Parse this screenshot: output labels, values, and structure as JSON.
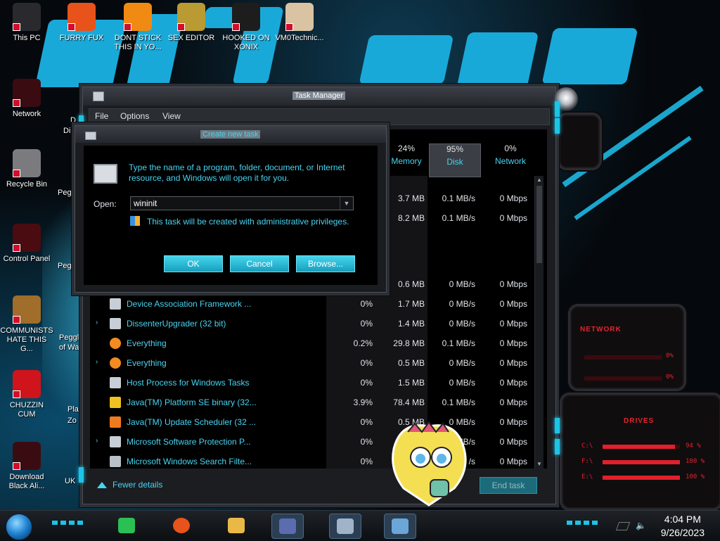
{
  "desktop": {
    "icons": [
      {
        "label": "This PC",
        "color": "#2a2a2e",
        "glyph": "pc-icon"
      },
      {
        "label": "FURRY FUX",
        "color": "#e8531b",
        "glyph": "firefox-icon"
      },
      {
        "label": "DONT STICK THIS IN YO...",
        "color": "#f08a12",
        "glyph": "vlc-icon"
      },
      {
        "label": "SEX EDITOR",
        "color": "#b99a33",
        "glyph": "hxd-icon"
      },
      {
        "label": "HOOKED ON XONIX",
        "color": "#1d1d1d",
        "glyph": "xonix-icon"
      },
      {
        "label": "VM0Technic...",
        "color": "#d9c3a3",
        "glyph": "doctor-icon"
      },
      {
        "label": "Network",
        "color": "#3a0c12",
        "glyph": "alien-network-icon"
      },
      {
        "label": "Recycle Bin",
        "color": "#7b7b7f",
        "glyph": "recycle-bin-icon"
      },
      {
        "label": "Control Panel",
        "color": "#4a0c10",
        "glyph": "control-panel-icon"
      },
      {
        "label": "COMMUNISTS HATE THIS G...",
        "color": "#a06d2a",
        "glyph": "money-bag-icon"
      },
      {
        "label": "CHUZZIN CUM",
        "color": "#d0141c",
        "glyph": "chuzzle-icon"
      },
      {
        "label": "Download Black Ali...",
        "color": "#3a0c12",
        "glyph": "alien-download-icon"
      }
    ],
    "partial_labels": [
      "D",
      "Di",
      "Pegg",
      "Peg",
      "Peggl",
      "of Wa",
      "Pla",
      "Zo",
      "UK"
    ]
  },
  "task_manager": {
    "title": "Task Manager",
    "menu": [
      "File",
      "Options",
      "View"
    ],
    "columns": [
      {
        "pct": "24%",
        "name": "Memory",
        "active": false
      },
      {
        "pct": "95%",
        "name": "Disk",
        "active": true
      },
      {
        "pct": "0%",
        "name": "Network",
        "active": false
      }
    ],
    "rows": [
      {
        "expand": false,
        "name": "",
        "cpu": "",
        "mem": "3.7 MB",
        "disk": "0.1 MB/s",
        "net": "0 Mbps"
      },
      {
        "expand": false,
        "name": "",
        "cpu": "",
        "mem": "8.2 MB",
        "disk": "0.1 MB/s",
        "net": "0 Mbps"
      },
      {
        "expand": false,
        "name": "",
        "cpu": "",
        "mem": "0.6 MB",
        "disk": "0 MB/s",
        "net": "0 Mbps"
      },
      {
        "expand": false,
        "name": "Device Association Framework ...",
        "cpu": "0%",
        "mem": "1.7 MB",
        "disk": "0 MB/s",
        "net": "0 Mbps",
        "icon": "process-icon"
      },
      {
        "expand": true,
        "name": "DissenterUpgrader (32 bit)",
        "cpu": "0%",
        "mem": "1.4 MB",
        "disk": "0 MB/s",
        "net": "0 Mbps",
        "icon": "process-icon"
      },
      {
        "expand": false,
        "name": "Everything",
        "cpu": "0.2%",
        "mem": "29.8 MB",
        "disk": "0.1 MB/s",
        "net": "0 Mbps",
        "icon": "magnifier-icon"
      },
      {
        "expand": true,
        "name": "Everything",
        "cpu": "0%",
        "mem": "0.5 MB",
        "disk": "0 MB/s",
        "net": "0 Mbps",
        "icon": "magnifier-icon"
      },
      {
        "expand": false,
        "name": "Host Process for Windows Tasks",
        "cpu": "0%",
        "mem": "1.5 MB",
        "disk": "0 MB/s",
        "net": "0 Mbps",
        "icon": "process-icon"
      },
      {
        "expand": false,
        "name": "Java(TM) Platform SE binary (32...",
        "cpu": "3.9%",
        "mem": "78.4 MB",
        "disk": "0.1 MB/s",
        "net": "0 Mbps",
        "icon": "java-icon"
      },
      {
        "expand": false,
        "name": "Java(TM) Update Scheduler (32 ...",
        "cpu": "0%",
        "mem": "0.5 MB",
        "disk": "0 MB/s",
        "net": "0 Mbps",
        "icon": "java-update-icon"
      },
      {
        "expand": true,
        "name": "Microsoft Software Protection P...",
        "cpu": "0%",
        "mem": "",
        "disk": "0 MB/s",
        "net": "0 Mbps",
        "icon": "process-icon"
      },
      {
        "expand": false,
        "name": "Microsoft Windows Search Filte...",
        "cpu": "0%",
        "mem": "",
        "disk": "/s",
        "net": "0 Mbps",
        "icon": "search-filter-icon"
      }
    ],
    "fewer_details": "Fewer details",
    "end_task": "End task"
  },
  "dialog": {
    "title": "Create new task",
    "description": "Type the name of a program, folder, document, or Internet resource, and Windows will open it for you.",
    "open_label": "Open:",
    "open_value": "wininit",
    "admin_note": "This task will be created with administrative privileges.",
    "ok": "OK",
    "cancel": "Cancel",
    "browse": "Browse..."
  },
  "widgets": {
    "network_header": "NETWORK",
    "network_values": [
      "0%",
      "0%"
    ],
    "drives_header": "DRIVES",
    "drives": [
      {
        "letter": "C:\\",
        "pct": 94,
        "label": "94 %"
      },
      {
        "letter": "F:\\",
        "pct": 100,
        "label": "100 %"
      },
      {
        "letter": "E:\\",
        "pct": 100,
        "label": "100 %"
      }
    ]
  },
  "taskbar": {
    "time": "4:04 PM",
    "date": "9/26/2023",
    "items": [
      {
        "name": "notes-app-icon",
        "color": "#2bbf54"
      },
      {
        "name": "firefox-icon",
        "color": "#e8531b"
      },
      {
        "name": "file-explorer-icon",
        "color": "#e9b948"
      },
      {
        "name": "control-panel-icon",
        "color": "#5b6cb0"
      },
      {
        "name": "task-manager-icon",
        "color": "#9fb4c8"
      },
      {
        "name": "run-dialog-icon",
        "color": "#6aa7d8"
      }
    ]
  }
}
